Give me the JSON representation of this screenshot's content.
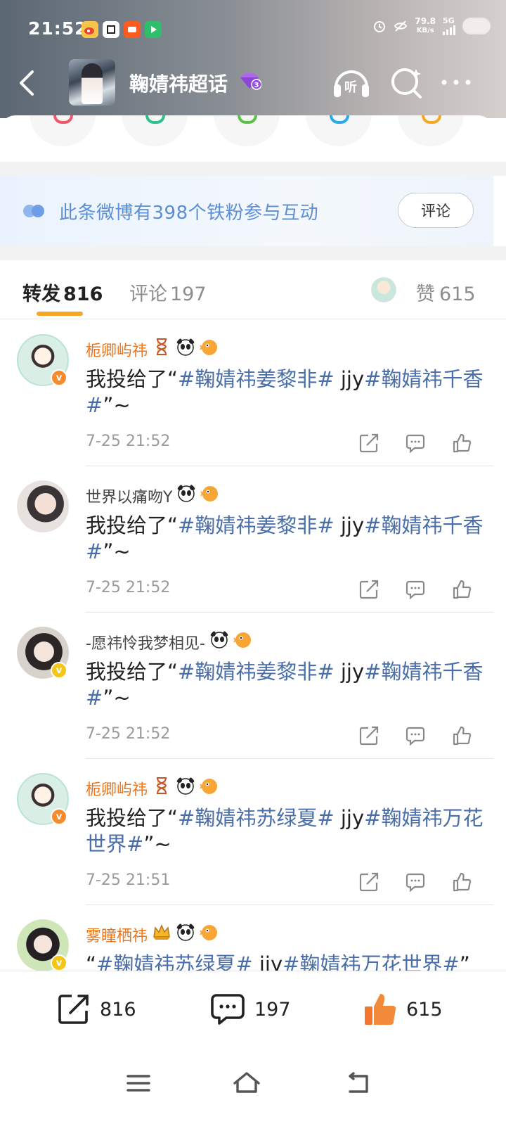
{
  "status_bar": {
    "time": "21:52",
    "net_speed": "79.8",
    "net_speed_unit": "KB/s",
    "network": "5G"
  },
  "header": {
    "title": "鞠婧祎超话",
    "listen_label": "听"
  },
  "fans_banner": {
    "text": "此条微博有398个铁粉参与互动",
    "button": "评论"
  },
  "tabs": {
    "repost_label": "转发",
    "repost_count": "816",
    "comment_label": "评论",
    "comment_count": "197",
    "like_label": "赞",
    "like_count": "615"
  },
  "feed": [
    {
      "user": "栀卿屿祎",
      "text_prefix": "我投给了“",
      "topic1": "#鞠婧祎姜黎非#",
      "mid": " jjy",
      "topic2": "#鞠婧祎千香#",
      "text_suffix": "”~",
      "time": "7-25 21:52"
    },
    {
      "user": "世界以痛吻Y",
      "text_prefix": "我投给了“",
      "topic1": "#鞠婧祎姜黎非#",
      "mid": " jjy",
      "topic2": "#鞠婧祎千香#",
      "text_suffix": "”~",
      "time": "7-25 21:52"
    },
    {
      "user": "-愿祎怜我梦相见-",
      "text_prefix": "我投给了“",
      "topic1": "#鞠婧祎姜黎非#",
      "mid": " jjy",
      "topic2": "#鞠婧祎千香#",
      "text_suffix": "”~",
      "time": "7-25 21:52"
    },
    {
      "user": "栀卿屿祎",
      "text_prefix": "我投给了“",
      "topic1": "#鞠婧祎苏绿夏#",
      "mid": " jjy",
      "topic2": "#鞠婧祎万花世界#",
      "text_suffix": "”~",
      "time": "7-25 21:51"
    },
    {
      "user": "雾瞳栖祎",
      "text_prefix": "“",
      "topic1": "#鞠婧祎苏绿夏#",
      "mid": " jjy",
      "topic2": "#鞠婧祎万花世界#",
      "text_suffix": "”"
    }
  ],
  "bottom_bar": {
    "repost_count": "816",
    "comment_count": "197",
    "like_count": "615"
  },
  "colors": {
    "accent_orange": "#f5a623",
    "username_orange": "#e8761f",
    "topic_blue": "#4a6eaa",
    "banner_text_blue": "#5b8ed6",
    "like_orange": "#f2762e"
  }
}
